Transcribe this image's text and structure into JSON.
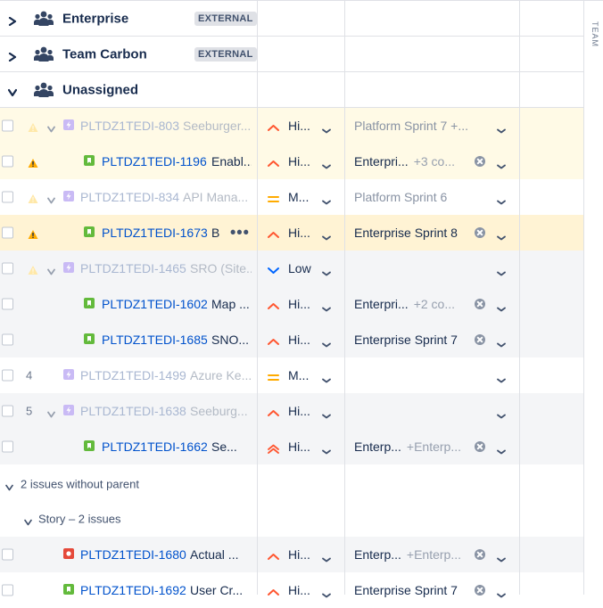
{
  "columns": {
    "team_header": "TEAM"
  },
  "groups": [
    {
      "name": "Enterprise",
      "badge": "EXTERNAL",
      "expanded": false
    },
    {
      "name": "Team Carbon",
      "badge": "EXTERNAL",
      "expanded": false
    },
    {
      "name": "Unassigned",
      "badge": "",
      "expanded": true
    }
  ],
  "rows": [
    {
      "bg": "#fffae6",
      "rank": "",
      "warning": true,
      "warningFaded": true,
      "hasChevron": true,
      "type": "epic",
      "level": 0,
      "key": "PLTDZ1TEDI-803",
      "summary": "Seeburger...",
      "faded": true,
      "priority": {
        "label": "Hi...",
        "kind": "high"
      },
      "sprint": {
        "label": "Platform Sprint 7 +...",
        "more": "",
        "faded": true
      },
      "clearable": false,
      "dots": false
    },
    {
      "bg": "#fffae6",
      "rank": "",
      "warning": true,
      "warningFaded": false,
      "hasChevron": false,
      "type": "story",
      "level": 1,
      "key": "PLTDZ1TEDI-1196",
      "summary": "Enabl...",
      "faded": false,
      "priority": {
        "label": "Hi...",
        "kind": "high"
      },
      "sprint": {
        "label": "Enterpri...",
        "more": "+3 co...",
        "faded": false
      },
      "clearable": true,
      "dots": false
    },
    {
      "bg": "#ffffff",
      "rank": "",
      "warning": true,
      "warningFaded": true,
      "hasChevron": true,
      "type": "epic",
      "level": 0,
      "key": "PLTDZ1TEDI-834",
      "summary": "API Mana...",
      "faded": true,
      "priority": {
        "label": "M...",
        "kind": "medium"
      },
      "sprint": {
        "label": "Platform Sprint 6",
        "more": "",
        "faded": true
      },
      "clearable": false,
      "dots": false
    },
    {
      "bg": "#fff3d4",
      "rank": "",
      "warning": true,
      "warningFaded": false,
      "hasChevron": false,
      "type": "story",
      "level": 1,
      "key": "PLTDZ1TEDI-1673",
      "summary": "B",
      "faded": false,
      "priority": {
        "label": "Hi...",
        "kind": "high"
      },
      "sprint": {
        "label": "Enterprise Sprint 8",
        "more": "",
        "faded": false
      },
      "clearable": true,
      "dots": true
    },
    {
      "bg": "#f4f5f7",
      "rank": "",
      "warning": true,
      "warningFaded": true,
      "hasChevron": true,
      "type": "epic",
      "level": 0,
      "key": "PLTDZ1TEDI-1465",
      "summary": "SRO (Site...",
      "faded": true,
      "priority": {
        "label": "Low",
        "kind": "low"
      },
      "sprint": {
        "label": "",
        "more": "",
        "faded": false
      },
      "clearable": false,
      "dots": false
    },
    {
      "bg": "#f4f5f7",
      "rank": "",
      "warning": false,
      "warningFaded": false,
      "hasChevron": false,
      "type": "story",
      "level": 1,
      "key": "PLTDZ1TEDI-1602",
      "summary": "Map ...",
      "faded": false,
      "priority": {
        "label": "Hi...",
        "kind": "high"
      },
      "sprint": {
        "label": "Enterpri...",
        "more": "+2 co...",
        "faded": false
      },
      "clearable": true,
      "dots": false
    },
    {
      "bg": "#f4f5f7",
      "rank": "",
      "warning": false,
      "warningFaded": false,
      "hasChevron": false,
      "type": "story",
      "level": 1,
      "key": "PLTDZ1TEDI-1685",
      "summary": "SNO...",
      "faded": false,
      "priority": {
        "label": "Hi...",
        "kind": "high"
      },
      "sprint": {
        "label": "Enterprise Sprint 7",
        "more": "",
        "faded": false
      },
      "clearable": true,
      "dots": false
    },
    {
      "bg": "#ffffff",
      "rank": "4",
      "warning": false,
      "warningFaded": false,
      "hasChevron": false,
      "type": "epic",
      "level": 0,
      "key": "PLTDZ1TEDI-1499",
      "summary": "Azure Ke...",
      "faded": true,
      "priority": {
        "label": "M...",
        "kind": "medium"
      },
      "sprint": {
        "label": "",
        "more": "",
        "faded": false
      },
      "clearable": false,
      "dots": false
    },
    {
      "bg": "#f4f5f7",
      "rank": "5",
      "warning": false,
      "warningFaded": false,
      "hasChevron": true,
      "type": "epic",
      "level": 0,
      "key": "PLTDZ1TEDI-1638",
      "summary": "Seeburg...",
      "faded": true,
      "priority": {
        "label": "Hi...",
        "kind": "high"
      },
      "sprint": {
        "label": "",
        "more": "",
        "faded": false
      },
      "clearable": false,
      "dots": false
    },
    {
      "bg": "#f4f5f7",
      "rank": "",
      "warning": false,
      "warningFaded": false,
      "hasChevron": false,
      "type": "story",
      "level": 1,
      "key": "PLTDZ1TEDI-1662",
      "summary": "Se...",
      "faded": false,
      "priority": {
        "label": "Hi...",
        "kind": "highest"
      },
      "sprint": {
        "label": "Enterp...",
        "more": "+Enterp...",
        "faded": false
      },
      "clearable": true,
      "dots": false
    }
  ],
  "orphans": {
    "header": "2 issues without parent",
    "subheader": "Story – 2 issues",
    "rows": [
      {
        "bg": "#f4f5f7",
        "type": "bug",
        "key": "PLTDZ1TEDI-1680",
        "summary": "Actual ...",
        "priority": {
          "label": "Hi...",
          "kind": "high"
        },
        "sprint": {
          "label": "Enterp...",
          "more": "+Enterp..."
        },
        "clearable": true
      },
      {
        "bg": "#ffffff",
        "type": "story",
        "key": "PLTDZ1TEDI-1692",
        "summary": "User Cr...",
        "priority": {
          "label": "Hi...",
          "kind": "high"
        },
        "sprint": {
          "label": "Enterprise Sprint 7",
          "more": ""
        },
        "clearable": true
      }
    ]
  },
  "colors": {
    "link": "#0052cc",
    "priority_high": "#ff5630",
    "priority_medium": "#ffab00",
    "priority_low": "#0065ff",
    "warning": "#ffab00"
  },
  "icons": {
    "group": "team-icon",
    "collapse": "chevron-right-icon",
    "expand": "chevron-down-icon",
    "epic": "epic-lightning-icon",
    "story": "story-bookmark-icon",
    "bug": "bug-icon",
    "warning": "warning-icon",
    "clear": "clear-icon",
    "dropdown": "chevron-down-icon"
  }
}
